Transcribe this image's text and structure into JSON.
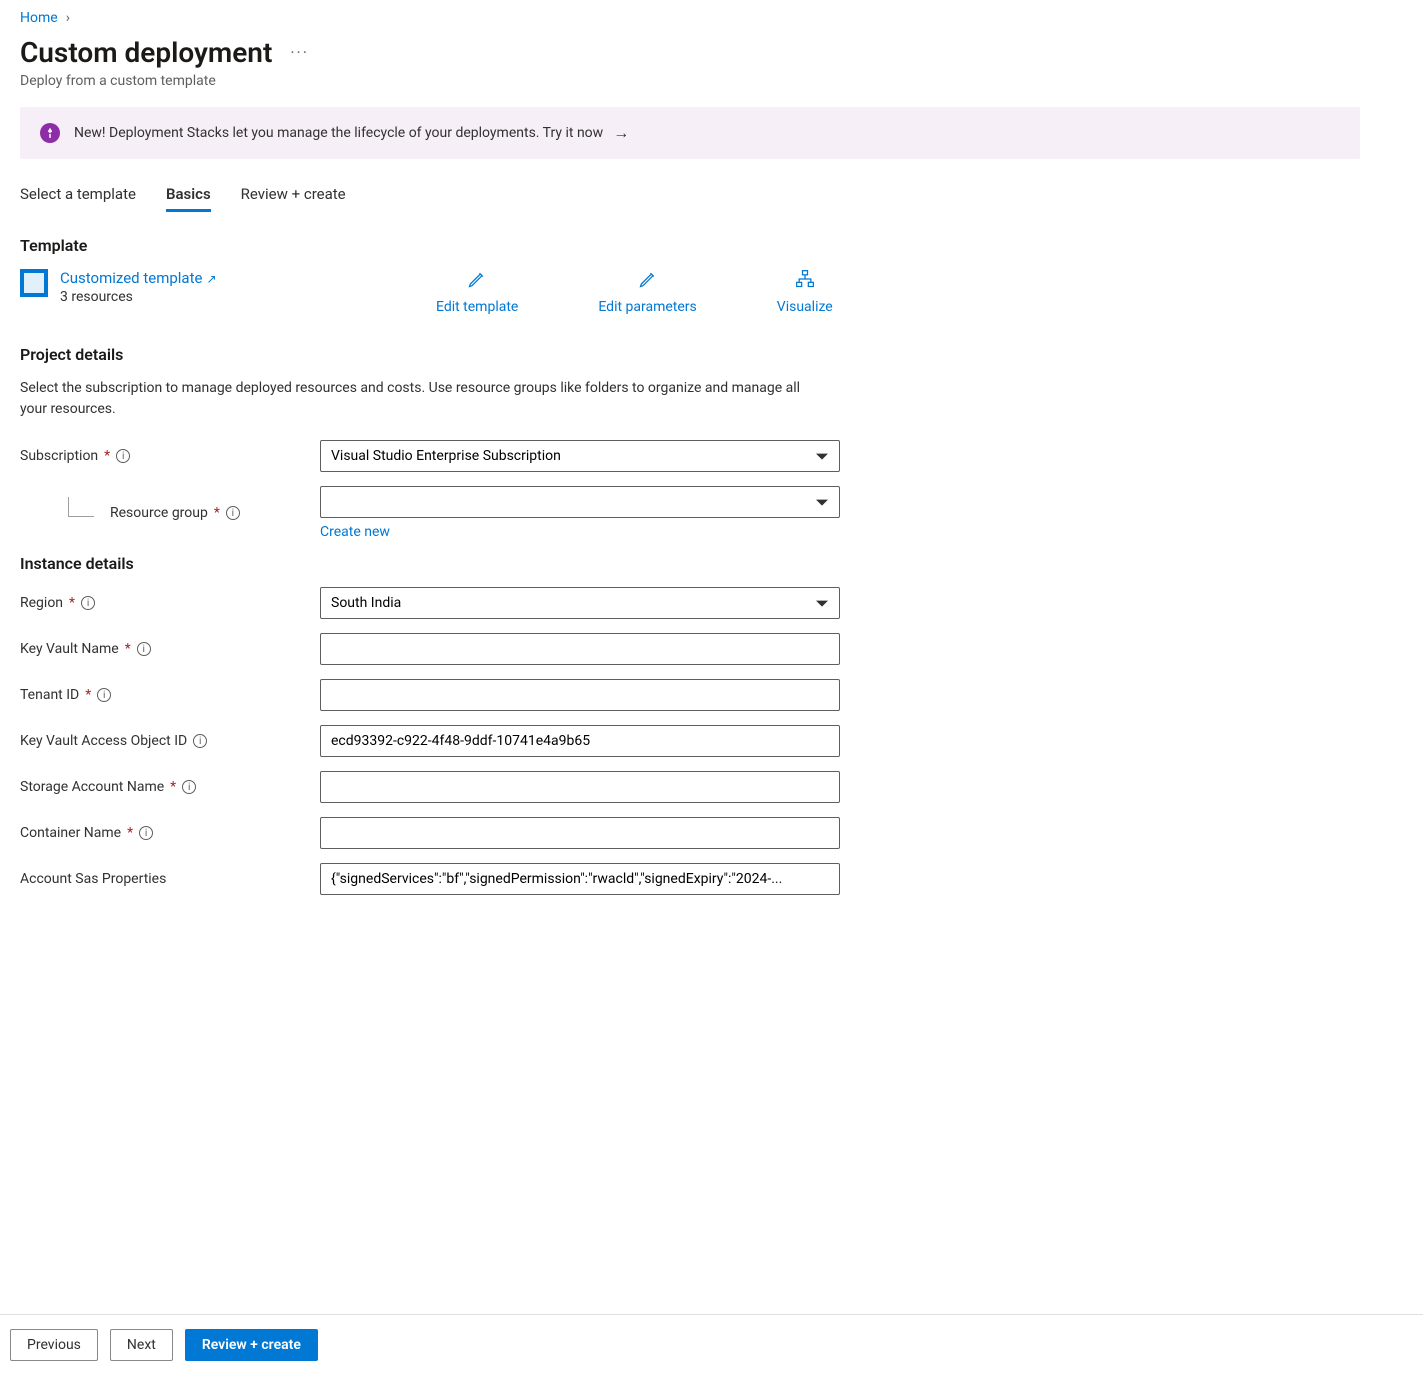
{
  "breadcrumb": {
    "home": "Home"
  },
  "header": {
    "title": "Custom deployment",
    "subtitle": "Deploy from a custom template"
  },
  "banner": {
    "text": "New! Deployment Stacks let you manage the lifecycle of your deployments. Try it now"
  },
  "tabs": {
    "select_template": "Select a template",
    "basics": "Basics",
    "review_create": "Review + create"
  },
  "template": {
    "section": "Template",
    "link": "Customized template",
    "resources": "3 resources",
    "edit_template": "Edit template",
    "edit_parameters": "Edit parameters",
    "visualize": "Visualize"
  },
  "project": {
    "section": "Project details",
    "desc": "Select the subscription to manage deployed resources and costs. Use resource groups like folders to organize and manage all your resources.",
    "subscription_label": "Subscription",
    "subscription_value": "Visual Studio Enterprise Subscription",
    "rg_label": "Resource group",
    "rg_value": "",
    "create_new": "Create new"
  },
  "instance": {
    "section": "Instance details",
    "region_label": "Region",
    "region_value": "South India",
    "key_vault_name_label": "Key Vault Name",
    "key_vault_name_value": "",
    "tenant_id_label": "Tenant ID",
    "tenant_id_value": "",
    "kv_access_obj_label": "Key Vault Access Object ID",
    "kv_access_obj_value": "ecd93392-c922-4f48-9ddf-10741e4a9b65",
    "storage_label": "Storage Account Name",
    "storage_value": "",
    "container_label": "Container Name",
    "container_value": "",
    "sas_label": "Account Sas Properties",
    "sas_value": "{\"signedServices\":\"bf\",\"signedPermission\":\"rwacld\",\"signedExpiry\":\"2024-..."
  },
  "footer": {
    "previous": "Previous",
    "next": "Next",
    "review_create": "Review + create"
  }
}
